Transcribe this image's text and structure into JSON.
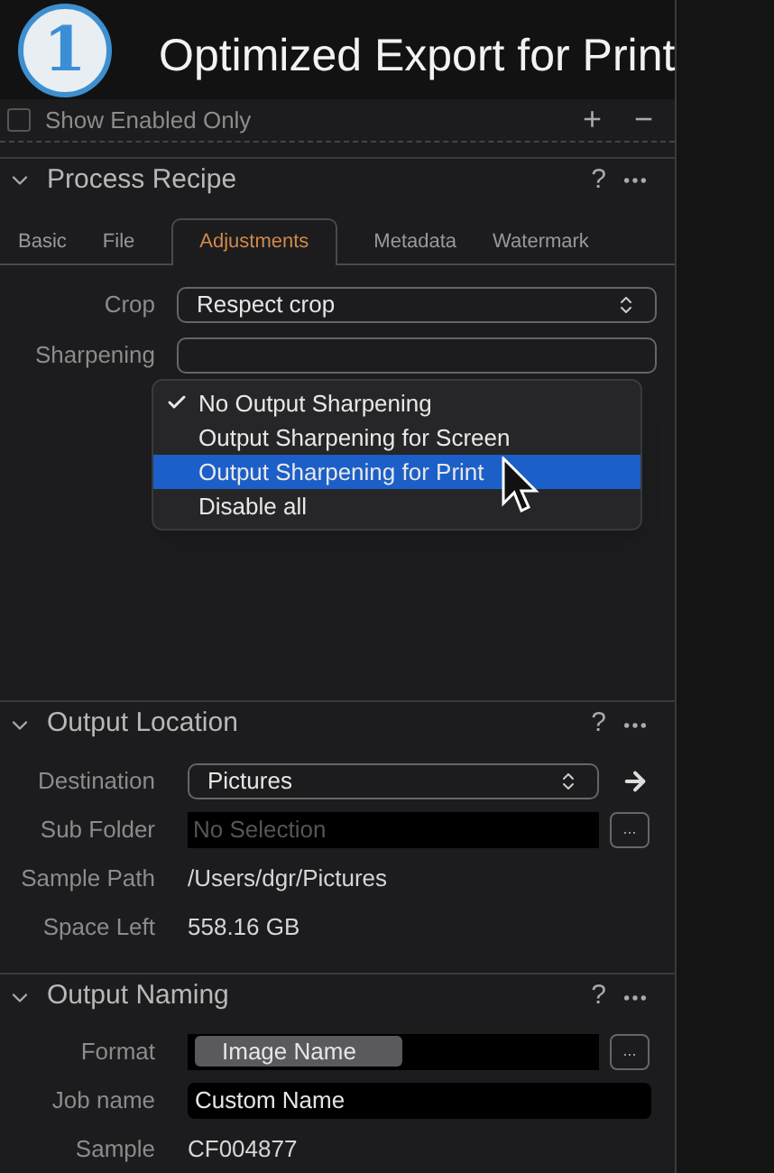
{
  "step_badge": "1",
  "title": "Optimized Export for Print",
  "filter": {
    "label": "Show Enabled Only",
    "checked": false,
    "add": "+",
    "remove": "−"
  },
  "process_recipe": {
    "title": "Process Recipe",
    "expanded": true,
    "help": "?",
    "tabs": [
      {
        "label": "Basic",
        "selected": false
      },
      {
        "label": "File",
        "selected": false
      },
      {
        "label": "Adjustments",
        "selected": true
      },
      {
        "label": "Metadata",
        "selected": false
      },
      {
        "label": "Watermark",
        "selected": false
      }
    ],
    "fields": [
      {
        "label": "Crop",
        "value": "Respect crop"
      },
      {
        "label": "Sharpening"
      }
    ],
    "menu": [
      {
        "label": "No Output Sharpening",
        "checked": true,
        "selected": false
      },
      {
        "label": "Output Sharpening for Screen",
        "checked": false,
        "selected": false
      },
      {
        "label": "Output Sharpening for Print",
        "checked": false,
        "selected": true
      },
      {
        "label": "Disable all",
        "checked": false,
        "selected": false
      }
    ]
  },
  "output_location": {
    "title": "Output Location",
    "expanded": true,
    "help": "?",
    "fields": [
      {
        "kind": "select",
        "label": "Destination",
        "value": "Pictures"
      },
      {
        "kind": "browse",
        "label": "Sub Folder",
        "placeholder": "No Selection",
        "button": "..."
      },
      {
        "kind": "text",
        "label": "Sample Path",
        "value": "/Users/dgr/Pictures"
      },
      {
        "kind": "text",
        "label": "Space Left",
        "value": "558.16 GB"
      }
    ]
  },
  "output_naming": {
    "title": "Output Naming",
    "expanded": true,
    "help": "?",
    "fields": [
      {
        "kind": "token",
        "label": "Format",
        "value": "Image Name",
        "button": "..."
      },
      {
        "kind": "input",
        "label": "Job name",
        "value": "Custom Name"
      },
      {
        "kind": "text",
        "label": "Sample",
        "value": "CF004877"
      }
    ]
  }
}
